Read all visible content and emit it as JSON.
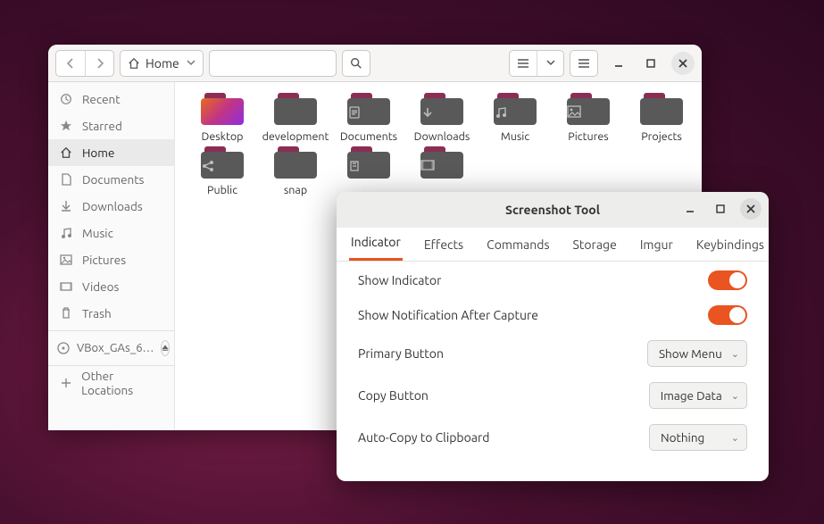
{
  "files": {
    "breadcrumb": "Home",
    "sidebar": {
      "recent": "Recent",
      "starred": "Starred",
      "home": "Home",
      "documents": "Documents",
      "downloads": "Downloads",
      "music": "Music",
      "pictures": "Pictures",
      "videos": "Videos",
      "trash": "Trash",
      "device": "VBox_GAs_6…",
      "other": "Other Locations"
    },
    "items": [
      {
        "label": "Desktop",
        "glyph": "",
        "gradient": true
      },
      {
        "label": "development",
        "glyph": ""
      },
      {
        "label": "Documents",
        "glyph": "doc"
      },
      {
        "label": "Downloads",
        "glyph": "down"
      },
      {
        "label": "Music",
        "glyph": "music"
      },
      {
        "label": "Pictures",
        "glyph": "pic"
      },
      {
        "label": "Projects",
        "glyph": ""
      },
      {
        "label": "Public",
        "glyph": "share"
      },
      {
        "label": "snap",
        "glyph": ""
      },
      {
        "label": "",
        "glyph": "temp"
      },
      {
        "label": "",
        "glyph": "video"
      }
    ]
  },
  "dialog": {
    "title": "Screenshot Tool",
    "tabs": [
      "Indicator",
      "Effects",
      "Commands",
      "Storage",
      "Imgur",
      "Keybindings"
    ],
    "active_tab": 0,
    "rows": {
      "show_indicator": "Show Indicator",
      "notif": "Show Notification After Capture",
      "primary": "Primary Button",
      "copy": "Copy Button",
      "auto": "Auto-Copy to Clipboard"
    },
    "values": {
      "primary": "Show Menu",
      "copy": "Image Data",
      "auto": "Nothing"
    }
  }
}
